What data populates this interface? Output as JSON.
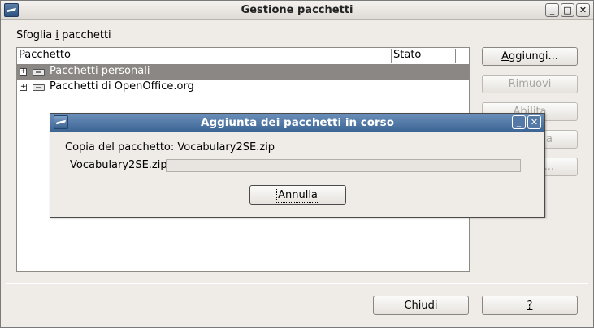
{
  "window": {
    "title": "Gestione pacchetti",
    "controls": {
      "minimize": "_",
      "maximize": "□",
      "close": "✕"
    }
  },
  "browse": {
    "label_pre": "Sfoglia ",
    "label_u": "i",
    "label_post": " pacchetti"
  },
  "list": {
    "columns": [
      "Pacchetto",
      "Stato"
    ],
    "rows": [
      {
        "label": "Pacchetti personali",
        "selected": true,
        "expander": "+"
      },
      {
        "label": "Pacchetti di OpenOffice.org",
        "selected": false,
        "expander": "+"
      }
    ]
  },
  "side_buttons": {
    "add": {
      "u": "A",
      "rest": "ggiungi..."
    },
    "remove": {
      "u": "R",
      "rest": "imuovi"
    },
    "enable": {
      "label": "Abilita"
    },
    "disable_partial": {
      "label": "a"
    },
    "export_partial": {
      "label": "..."
    }
  },
  "bottom_buttons": {
    "close": "Chiudi",
    "help": "?"
  },
  "dialog": {
    "title": "Aggiunta dei pacchetti in corso",
    "copy_text": "Copia del pacchetto: Vocabulary2SE.zip",
    "file_label": "Vocabulary2SE.zip",
    "progress_fraction": 0.0,
    "cancel_label": "Annulla",
    "controls": {
      "minimize": "_",
      "close": "✕"
    }
  },
  "colors": {
    "selection": "#8a8784",
    "dialog_title": "#3d6594"
  }
}
